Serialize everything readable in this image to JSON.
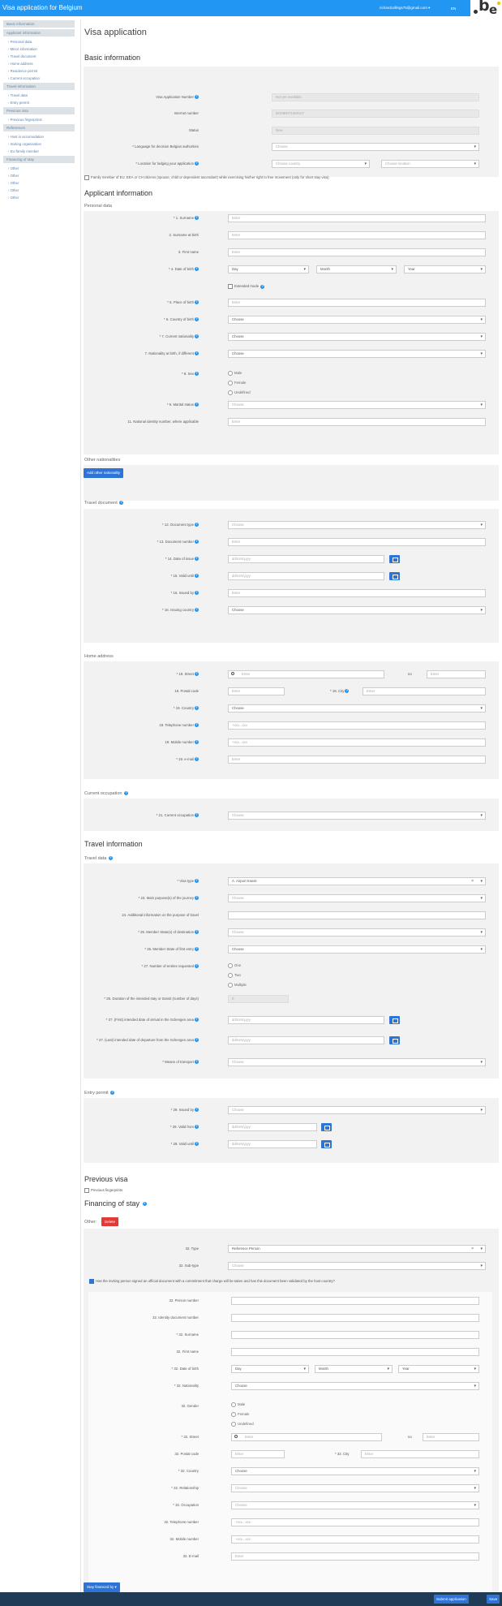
{
  "header": {
    "title": "Visa application for Belgium",
    "user": "richardcollings75@gmail.com ▾",
    "lang": "EN",
    "logo_b": "b",
    "logo_e": "e"
  },
  "sidebar": {
    "sections": [
      {
        "head": "Basic information",
        "items": []
      },
      {
        "head": "Applicant information",
        "items": [
          "Personal data",
          "Minor information",
          "Travel document",
          "Home address",
          "Residence permit",
          "Current occupation"
        ]
      },
      {
        "head": "Travel information",
        "items": [
          "Travel data",
          "Entry permit"
        ]
      },
      {
        "head": "Previous visa",
        "items": [
          "Previous fingerprints"
        ]
      },
      {
        "head": "References",
        "items": [
          "Host in accomodation",
          "Inviting organisation",
          "EU family member"
        ]
      },
      {
        "head": "Financing of stay",
        "items": [
          "Other",
          "Other",
          "Other",
          "Other",
          "Other"
        ]
      }
    ]
  },
  "page": {
    "title": "Visa application"
  },
  "basic": {
    "title": "Basic information",
    "app_no_label": "Visa Application Number",
    "app_no": "Not yet available",
    "internet_no_label": "Internet number",
    "internet_no": "BOMBNT1668107",
    "status_label": "Status",
    "status": "New",
    "lang_label": "Language for decision Belgian authorities",
    "lang_ph": "Choose",
    "loc_label": "Location for lodging your application",
    "country_ph": "Choose country",
    "location_ph": "Choose location",
    "family_member": "Family member of EU, EEA or CH citizens (spouse, child or dependent ascendant) while exercising his/her right to free movement (only for short stay visa)"
  },
  "applicant": {
    "title": "Applicant information",
    "personal_title": "Personal data",
    "surname": "1. Surname",
    "surname_birth": "2. Surname at birth",
    "first_name": "3. First name",
    "dob": "4. Date of birth",
    "day": "Day",
    "month": "Month",
    "year": "Year",
    "extended_mode": "Extended mode",
    "place_birth": "5. Place of birth",
    "country_birth": "6. Country of birth",
    "current_nat": "7. Current nationality",
    "nat_birth": "7. Nationality at birth, if different",
    "sex": "8. Sex",
    "male": "Male",
    "female": "Female",
    "undefined": "Undefined",
    "marital": "9. Marital status",
    "nat_id": "11. National identity number, where applicable",
    "enter": "Enter",
    "choose": "Choose",
    "other_nat_title": "Other nationalities",
    "add_nat": "Add other nationality"
  },
  "travel_doc": {
    "title": "Travel document",
    "doc_type": "12. Document type",
    "doc_no": "13. Document number",
    "issue_date": "14. Date of issue",
    "valid_until": "15. Valid until",
    "issued_by": "16. Issued by",
    "issuing_country": "16. Issuing country",
    "date_ph": "dd/mm/yyyy"
  },
  "home": {
    "title": "Home address",
    "street": "19. Street",
    "no": "no",
    "postal": "19. Postal code",
    "city": "19. City",
    "country": "19. Country",
    "tel": "19. Telephone number",
    "mobile": "19. Mobile number",
    "email": "19. e-mail",
    "phone_ph": "+xxx...xxx"
  },
  "occupation": {
    "title": "Current occupation",
    "label": "21. Current occupation"
  },
  "travel": {
    "title": "Travel information",
    "data_title": "Travel data",
    "visa_type": "Visa type",
    "visa_type_val": "A. Airport transit",
    "purpose": "23. Main purpose(s) of the journey",
    "add_info": "24. Additional information on the purpose of travel",
    "member_dest": "25. Member State(s) of destination",
    "member_first": "26. Member State of first entry",
    "entries": "27. Number of entries requested",
    "one": "One",
    "two": "Two",
    "multiple": "Multiple",
    "duration": "25. Duration of the intended stay or transit (number of days)",
    "duration_val": "0",
    "arrival": "27. (First) intended date of arrival in the Schengen area",
    "departure": "27. (Last) intended date of departure from the Schengen area",
    "transport": "Means of transport"
  },
  "entry": {
    "title": "Entry permit",
    "issued_by": "29. Issued by",
    "valid_from": "29. Valid from",
    "valid_until": "29. Valid until"
  },
  "prev_visa": {
    "title": "Previous visa",
    "fingerprints": "Previous fingerprints"
  },
  "financing": {
    "title": "Financing of stay",
    "other": "Other:",
    "delete": "Delete",
    "type": "32. Type",
    "type_val": "Reference Person",
    "subtype": "32. Sub-type",
    "signed": "Has the inviting person signed an official document with a commitment that charge will be taken and has this document been validated by the host country?",
    "person_no": "32. Person number",
    "id_doc": "32. Identity document number",
    "surname": "32. Surname",
    "first_name": "32. First name",
    "dob": "32. Date of birth",
    "nationality": "32. Nationality",
    "gender": "32. Gender",
    "street": "32. Street",
    "no": "no",
    "postal": "32. Postal code",
    "city": "32. City",
    "country": "32. Country",
    "relationship": "32. Relationship",
    "occupation": "32. Occupation",
    "tel": "32. Telephone number",
    "mobile": "32. Mobile number",
    "email": "32. E-mail",
    "stay_btn": "Stay financed by ▾"
  },
  "footer": {
    "submit": "Submit application",
    "save": "Save"
  }
}
